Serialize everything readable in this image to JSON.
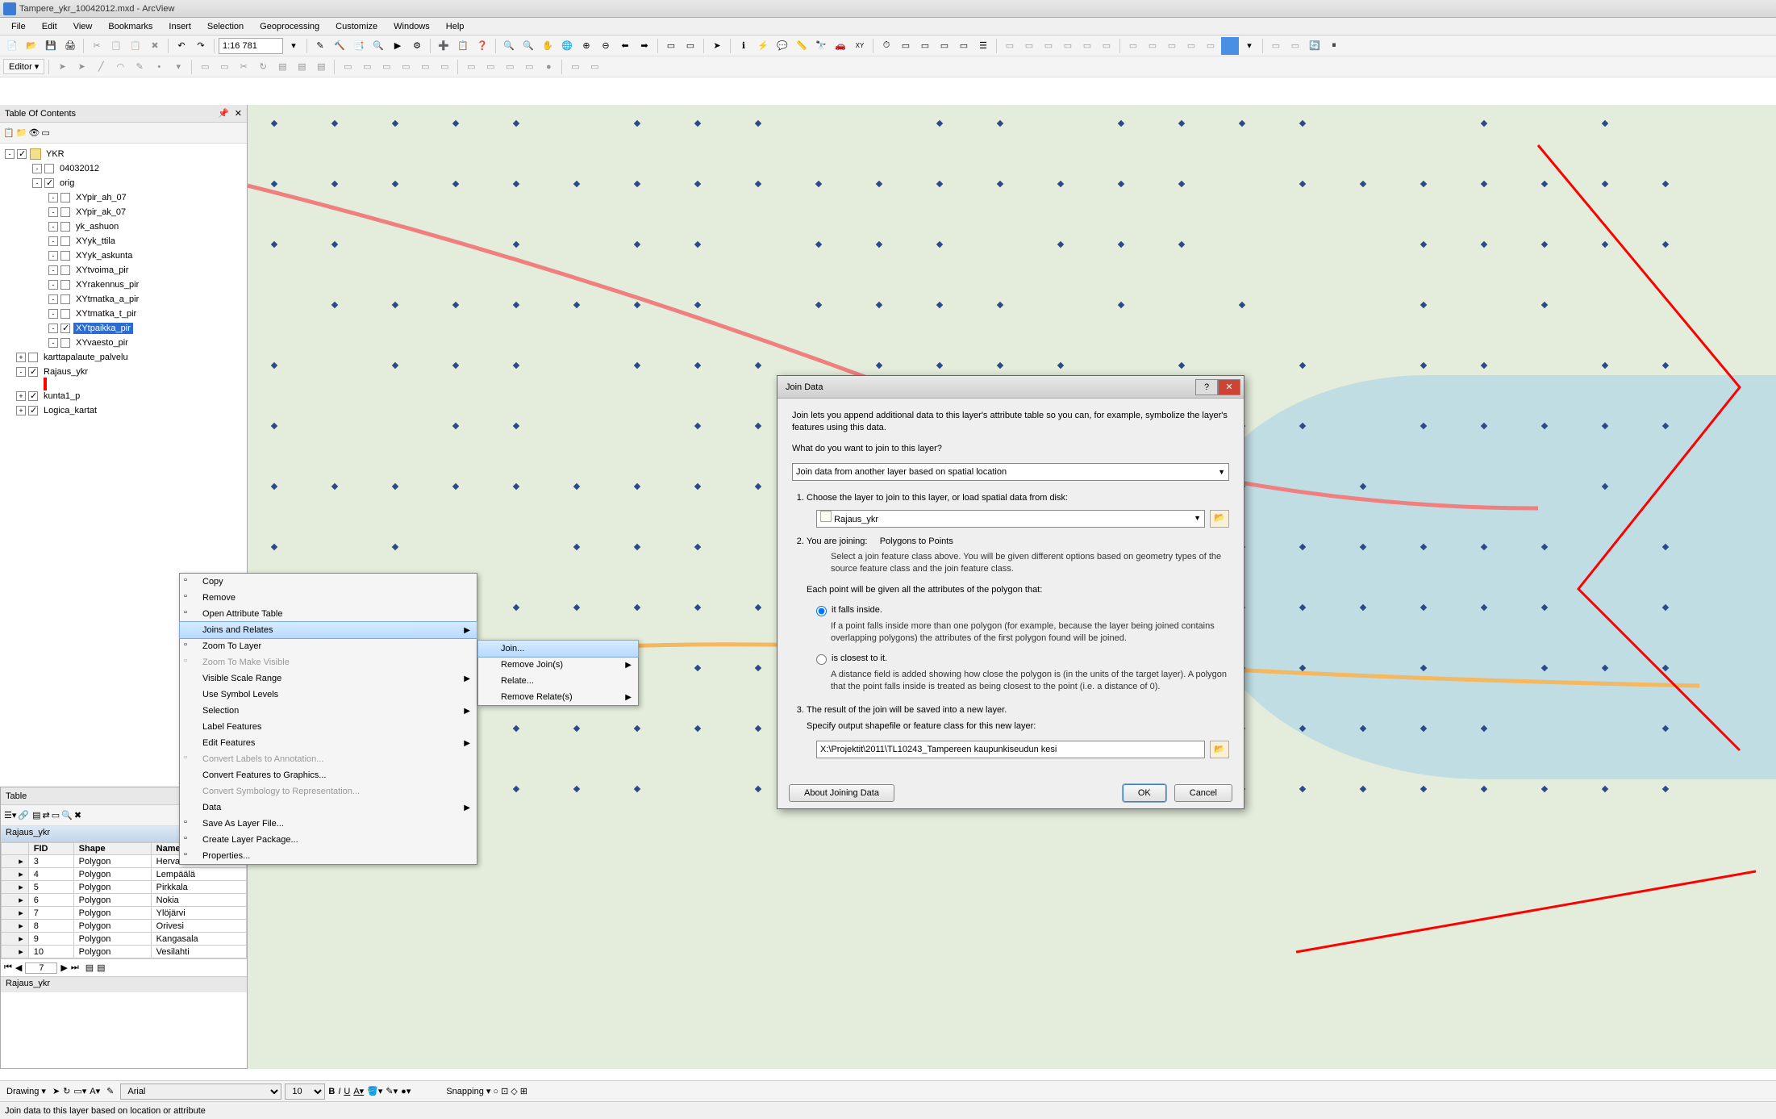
{
  "titlebar": {
    "doc": "Tampere_ykr_10042012.mxd",
    "app": "ArcView"
  },
  "menubar": [
    "File",
    "Edit",
    "View",
    "Bookmarks",
    "Insert",
    "Selection",
    "Geoprocessing",
    "Customize",
    "Windows",
    "Help"
  ],
  "scale": "1:16 781",
  "editor_label": "Editor",
  "toc": {
    "title": "Table Of Contents",
    "root": {
      "label": "YKR",
      "checked": true
    },
    "nodes": [
      {
        "indent": 1,
        "expand": "-",
        "checked": false,
        "label": "04032012"
      },
      {
        "indent": 1,
        "expand": "-",
        "checked": true,
        "label": "orig"
      },
      {
        "indent": 2,
        "expand": "-",
        "checked": false,
        "label": "XYpir_ah_07"
      },
      {
        "indent": 2,
        "expand": "-",
        "checked": false,
        "label": "XYpir_ak_07"
      },
      {
        "indent": 2,
        "expand": "-",
        "checked": false,
        "label": "yk_ashuon"
      },
      {
        "indent": 2,
        "expand": "-",
        "checked": false,
        "label": "XYyk_ttila"
      },
      {
        "indent": 2,
        "expand": "-",
        "checked": false,
        "label": "XYyk_askunta"
      },
      {
        "indent": 2,
        "expand": "-",
        "checked": false,
        "label": "XYtvoima_pir"
      },
      {
        "indent": 2,
        "expand": "-",
        "checked": false,
        "label": "XYrakennus_pir"
      },
      {
        "indent": 2,
        "expand": "-",
        "checked": false,
        "label": "XYtmatka_a_pir"
      },
      {
        "indent": 2,
        "expand": "-",
        "checked": false,
        "label": "XYtmatka_t_pir"
      },
      {
        "indent": 2,
        "expand": "-",
        "checked": true,
        "label": "XYtpaikka_pir",
        "selected": true
      },
      {
        "indent": 2,
        "expand": "-",
        "checked": false,
        "label": "XYvaesto_pir"
      },
      {
        "indent": 0,
        "expand": "+",
        "checked": false,
        "label": "karttapalaute_palvelu"
      },
      {
        "indent": 0,
        "expand": "-",
        "checked": true,
        "label": "Rajaus_ykr"
      },
      {
        "indent": 0,
        "expand": "+",
        "checked": true,
        "label": "kunta1_p"
      },
      {
        "indent": 0,
        "expand": "+",
        "checked": true,
        "label": "Logica_kartat"
      }
    ]
  },
  "ctxmenu": {
    "items": [
      {
        "label": "Copy",
        "icon": "copy-icon"
      },
      {
        "label": "Remove",
        "icon": "remove-icon"
      },
      {
        "label": "Open Attribute Table",
        "icon": "table-icon"
      },
      {
        "label": "Joins and Relates",
        "submenu": true,
        "highlight": true
      },
      {
        "label": "Zoom To Layer",
        "icon": "zoom-icon"
      },
      {
        "label": "Zoom To Make Visible",
        "icon": "zoom-icon",
        "disabled": true
      },
      {
        "label": "Visible Scale Range",
        "submenu": true
      },
      {
        "label": "Use Symbol Levels"
      },
      {
        "label": "Selection",
        "submenu": true
      },
      {
        "label": "Label Features"
      },
      {
        "label": "Edit Features",
        "submenu": true
      },
      {
        "label": "Convert Labels to Annotation...",
        "icon": "convert-icon",
        "disabled": true
      },
      {
        "label": "Convert Features to Graphics..."
      },
      {
        "label": "Convert Symbology to Representation...",
        "disabled": true
      },
      {
        "label": "Data",
        "submenu": true
      },
      {
        "label": "Save As Layer File...",
        "icon": "save-icon"
      },
      {
        "label": "Create Layer Package...",
        "icon": "package-icon"
      },
      {
        "label": "Properties...",
        "icon": "props-icon"
      }
    ]
  },
  "submenu": {
    "items": [
      {
        "label": "Join...",
        "highlight": true
      },
      {
        "label": "Remove Join(s)",
        "submenu": true
      },
      {
        "label": "Relate..."
      },
      {
        "label": "Remove Relate(s)",
        "submenu": true
      }
    ]
  },
  "table": {
    "title": "Table",
    "tabname": "Rajaus_ykr",
    "headers": [
      "FID",
      "Shape",
      "Name"
    ],
    "rows": [
      [
        "3",
        "Polygon",
        "Hervanta"
      ],
      [
        "4",
        "Polygon",
        "Lempäälä"
      ],
      [
        "5",
        "Polygon",
        "Pirkkala"
      ],
      [
        "6",
        "Polygon",
        "Nokia"
      ],
      [
        "7",
        "Polygon",
        "Ylöjärvi"
      ],
      [
        "8",
        "Polygon",
        "Orivesi"
      ],
      [
        "9",
        "Polygon",
        "Kangasala"
      ],
      [
        "10",
        "Polygon",
        "Vesilahti"
      ]
    ],
    "nav_record": "7",
    "tab": "Rajaus_ykr"
  },
  "dialog": {
    "title": "Join Data",
    "intro": "Join lets you append additional data to this layer's attribute table so you can, for example, symbolize the layer's features using this data.",
    "q1": "What do you want to join to this layer?",
    "q1_val": "Join data from another layer based on spatial location",
    "step1": "Choose the layer to join to this layer, or load spatial data from disk:",
    "step1_val": "Rajaus_ykr",
    "step2_label": "You are joining:",
    "step2_val": "Polygons to Points",
    "step2_desc": "Select a join feature class above.  You will be given different options based on geometry types of the source feature class and the join feature class.",
    "step2_intro": "Each point will be given all the attributes of the polygon that:",
    "radio1": "it falls inside.",
    "radio1_desc": "If a point falls inside more than one polygon (for example, because the layer being joined contains overlapping polygons) the attributes of the first polygon found will be joined.",
    "radio2": "is closest to it.",
    "radio2_desc": "A distance field is added showing how close the polygon is (in the units of the target layer). A polygon that the point falls inside is treated as being closest to the point (i.e. a distance of 0).",
    "step3": "The result of the join will be saved into a new layer.",
    "step3_label": "Specify output shapefile or feature class for this new layer:",
    "output_val": "X:\\Projektit\\2011\\TL10243_Tampereen kaupunkiseudun kesi",
    "about_btn": "About Joining Data",
    "ok_btn": "OK",
    "cancel_btn": "Cancel"
  },
  "drawing": {
    "label": "Drawing",
    "font": "Arial",
    "size": "10",
    "snapping": "Snapping"
  },
  "status": "Join data to this layer based on location or attribute"
}
